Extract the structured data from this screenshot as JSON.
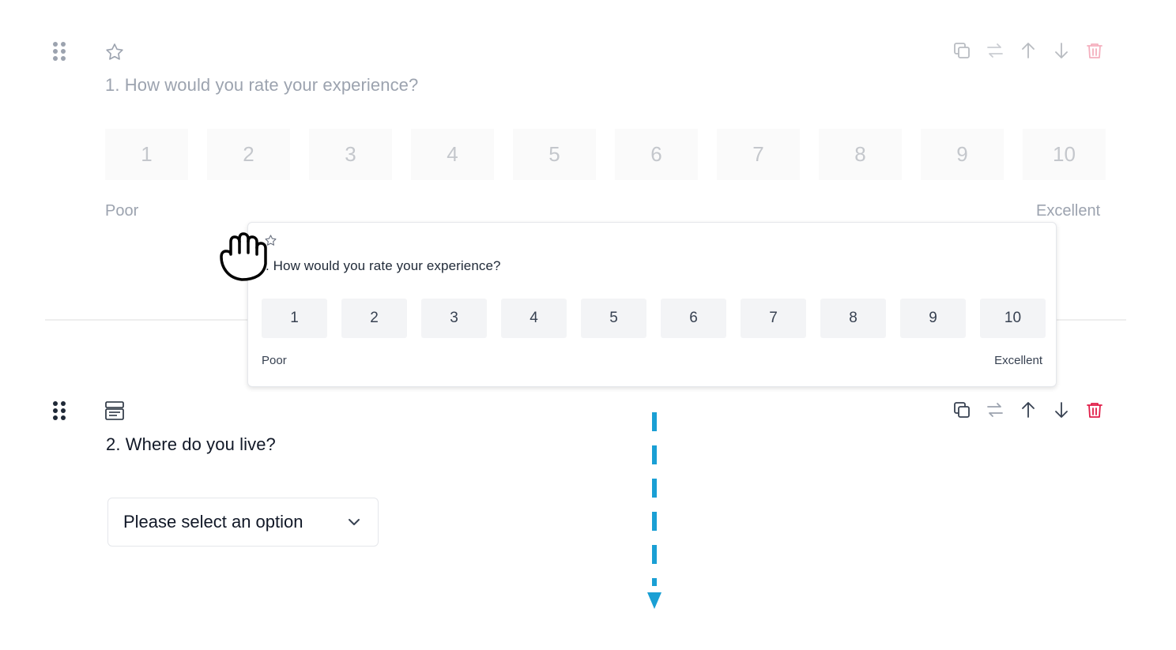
{
  "question1": {
    "title": "1. How would you rate your experience?",
    "options": [
      "1",
      "2",
      "3",
      "4",
      "5",
      "6",
      "7",
      "8",
      "9",
      "10"
    ],
    "low_label": "Poor",
    "high_label": "Excellent",
    "type_icon": "star-icon"
  },
  "drag_preview": {
    "title": ". How would you rate your experience?",
    "options": [
      "1",
      "2",
      "3",
      "4",
      "5",
      "6",
      "7",
      "8",
      "9",
      "10"
    ],
    "low_label": "Poor",
    "high_label": "Excellent"
  },
  "question2": {
    "title": "2. Where do you live?",
    "select_placeholder": "Please select an option",
    "type_icon": "dropdown-list-icon"
  },
  "toolbar_icons": [
    "duplicate-icon",
    "swap-icon",
    "arrow-up-icon",
    "arrow-down-icon",
    "trash-icon"
  ],
  "colors": {
    "delete": "#e11d48",
    "drop_indicator": "#1a9fd4",
    "text": "#1f2937"
  }
}
